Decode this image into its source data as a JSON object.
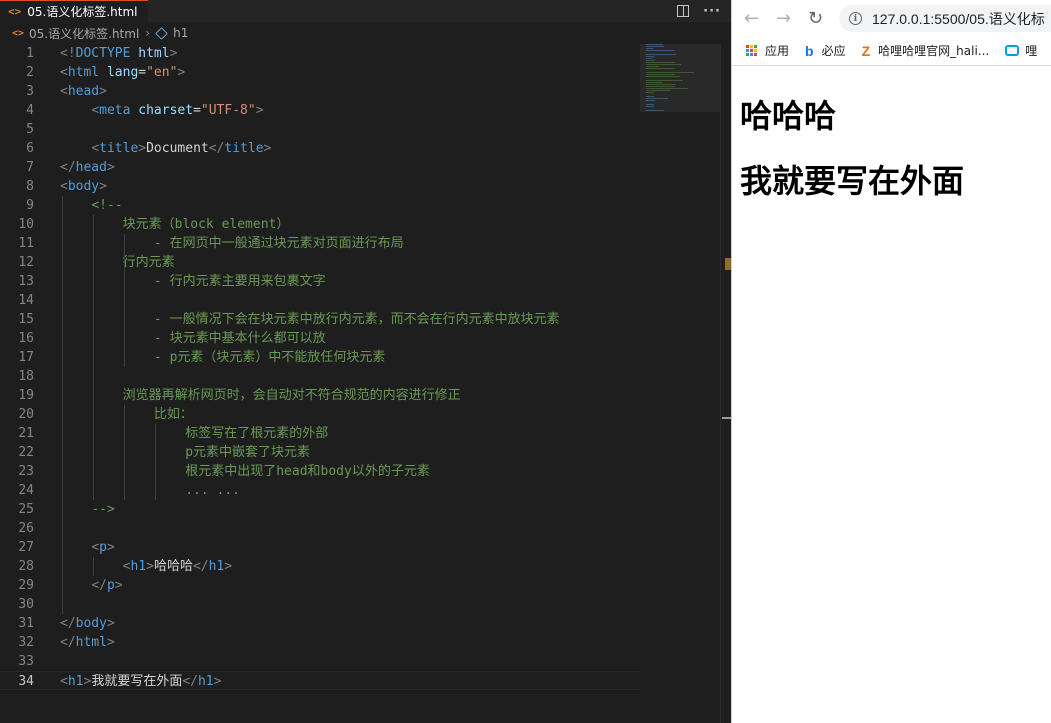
{
  "editor": {
    "tab_label": "05.语义化标签.html",
    "tab_icon": "html-file-icon",
    "breadcrumb_file": "05.语义化标签.html",
    "breadcrumb_symbol": "h1",
    "active_line": 34,
    "lines": [
      [
        [
          "t-punct",
          "<!"
        ],
        [
          "t-doctype",
          "DOCTYPE"
        ],
        [
          "t-text",
          " "
        ],
        [
          "t-attr",
          "html"
        ],
        [
          "t-punct",
          ">"
        ]
      ],
      [
        [
          "t-punct",
          "<"
        ],
        [
          "t-tag",
          "html"
        ],
        [
          "t-text",
          " "
        ],
        [
          "t-attr",
          "lang"
        ],
        [
          "t-text",
          "="
        ],
        [
          "t-str",
          "\"en\""
        ],
        [
          "t-punct",
          ">"
        ]
      ],
      [
        [
          "t-punct",
          "<"
        ],
        [
          "t-tag",
          "head"
        ],
        [
          "t-punct",
          ">"
        ]
      ],
      [
        [
          "t-text",
          "    "
        ],
        [
          "t-punct",
          "<"
        ],
        [
          "t-tag",
          "meta"
        ],
        [
          "t-text",
          " "
        ],
        [
          "t-attr",
          "charset"
        ],
        [
          "t-text",
          "="
        ],
        [
          "t-str",
          "\"UTF-8\""
        ],
        [
          "t-punct",
          ">"
        ]
      ],
      [],
      [
        [
          "t-text",
          "    "
        ],
        [
          "t-punct",
          "<"
        ],
        [
          "t-tag",
          "title"
        ],
        [
          "t-punct",
          ">"
        ],
        [
          "t-text",
          "Document"
        ],
        [
          "t-punct",
          "</"
        ],
        [
          "t-tag",
          "title"
        ],
        [
          "t-punct",
          ">"
        ]
      ],
      [
        [
          "t-punct",
          "</"
        ],
        [
          "t-tag",
          "head"
        ],
        [
          "t-punct",
          ">"
        ]
      ],
      [
        [
          "t-punct",
          "<"
        ],
        [
          "t-tag",
          "body"
        ],
        [
          "t-punct",
          ">"
        ]
      ],
      [
        [
          "t-text",
          "    "
        ],
        [
          "t-comment",
          "<!--"
        ]
      ],
      [
        [
          "t-comment",
          "        块元素（block element）"
        ]
      ],
      [
        [
          "t-comment",
          "            - 在网页中一般通过块元素对页面进行布局"
        ]
      ],
      [
        [
          "t-comment",
          "        行内元素"
        ]
      ],
      [
        [
          "t-comment",
          "            - 行内元素主要用来包裹文字"
        ]
      ],
      [],
      [
        [
          "t-comment",
          "            - 一般情况下会在块元素中放行内元素，而不会在行内元素中放块元素"
        ]
      ],
      [
        [
          "t-comment",
          "            - 块元素中基本什么都可以放"
        ]
      ],
      [
        [
          "t-comment",
          "            - p元素（块元素）中不能放任何块元素"
        ]
      ],
      [],
      [
        [
          "t-comment",
          "        浏览器再解析网页时，会自动对不符合规范的内容进行修正"
        ]
      ],
      [
        [
          "t-comment",
          "            比如："
        ]
      ],
      [
        [
          "t-comment",
          "                标签写在了根元素的外部"
        ]
      ],
      [
        [
          "t-comment",
          "                p元素中嵌套了块元素"
        ]
      ],
      [
        [
          "t-comment",
          "                根元素中出现了head和body以外的子元素"
        ]
      ],
      [
        [
          "t-comment",
          "                ... ..."
        ]
      ],
      [
        [
          "t-text",
          "    "
        ],
        [
          "t-comment",
          "-->"
        ]
      ],
      [],
      [
        [
          "t-text",
          "    "
        ],
        [
          "t-punct",
          "<"
        ],
        [
          "t-tag",
          "p"
        ],
        [
          "t-punct",
          ">"
        ]
      ],
      [
        [
          "t-text",
          "        "
        ],
        [
          "t-punct",
          "<"
        ],
        [
          "t-tag",
          "h1"
        ],
        [
          "t-punct",
          ">"
        ],
        [
          "t-text",
          "哈哈哈"
        ],
        [
          "t-punct",
          "</"
        ],
        [
          "t-tag",
          "h1"
        ],
        [
          "t-punct",
          ">"
        ]
      ],
      [
        [
          "t-text",
          "    "
        ],
        [
          "t-punct",
          "</"
        ],
        [
          "t-tag",
          "p"
        ],
        [
          "t-punct",
          ">"
        ]
      ],
      [],
      [
        [
          "t-punct",
          "</"
        ],
        [
          "t-tag",
          "body"
        ],
        [
          "t-punct",
          ">"
        ]
      ],
      [
        [
          "t-punct",
          "</"
        ],
        [
          "t-tag",
          "html"
        ],
        [
          "t-punct",
          ">"
        ]
      ],
      [],
      [
        [
          "t-punct",
          "<"
        ],
        [
          "t-tag",
          "h1"
        ],
        [
          "t-punct",
          ">"
        ],
        [
          "t-text",
          "我就要写在外面"
        ],
        [
          "t-punct",
          "</"
        ],
        [
          "t-tag",
          "h1"
        ],
        [
          "t-punct",
          ">"
        ]
      ]
    ]
  },
  "browser": {
    "url": "127.0.0.1:5500/05.语义化标",
    "bookmarks": [
      {
        "icon": "apps-grid-icon",
        "label": "应用"
      },
      {
        "icon": "bing-icon",
        "label": "必应"
      },
      {
        "icon": "zhihu-z-icon",
        "label": "哈哩哈哩官网_hali..."
      },
      {
        "icon": "bilibili-tv-icon",
        "label": "哩"
      }
    ],
    "page_headings": [
      "哈哈哈",
      "我就要写在外面"
    ]
  },
  "colors": {
    "editor_bg": "#1e1e1e",
    "comment": "#6a9955",
    "tag": "#569cd6",
    "string": "#ce9178",
    "attr": "#9cdcfe"
  }
}
